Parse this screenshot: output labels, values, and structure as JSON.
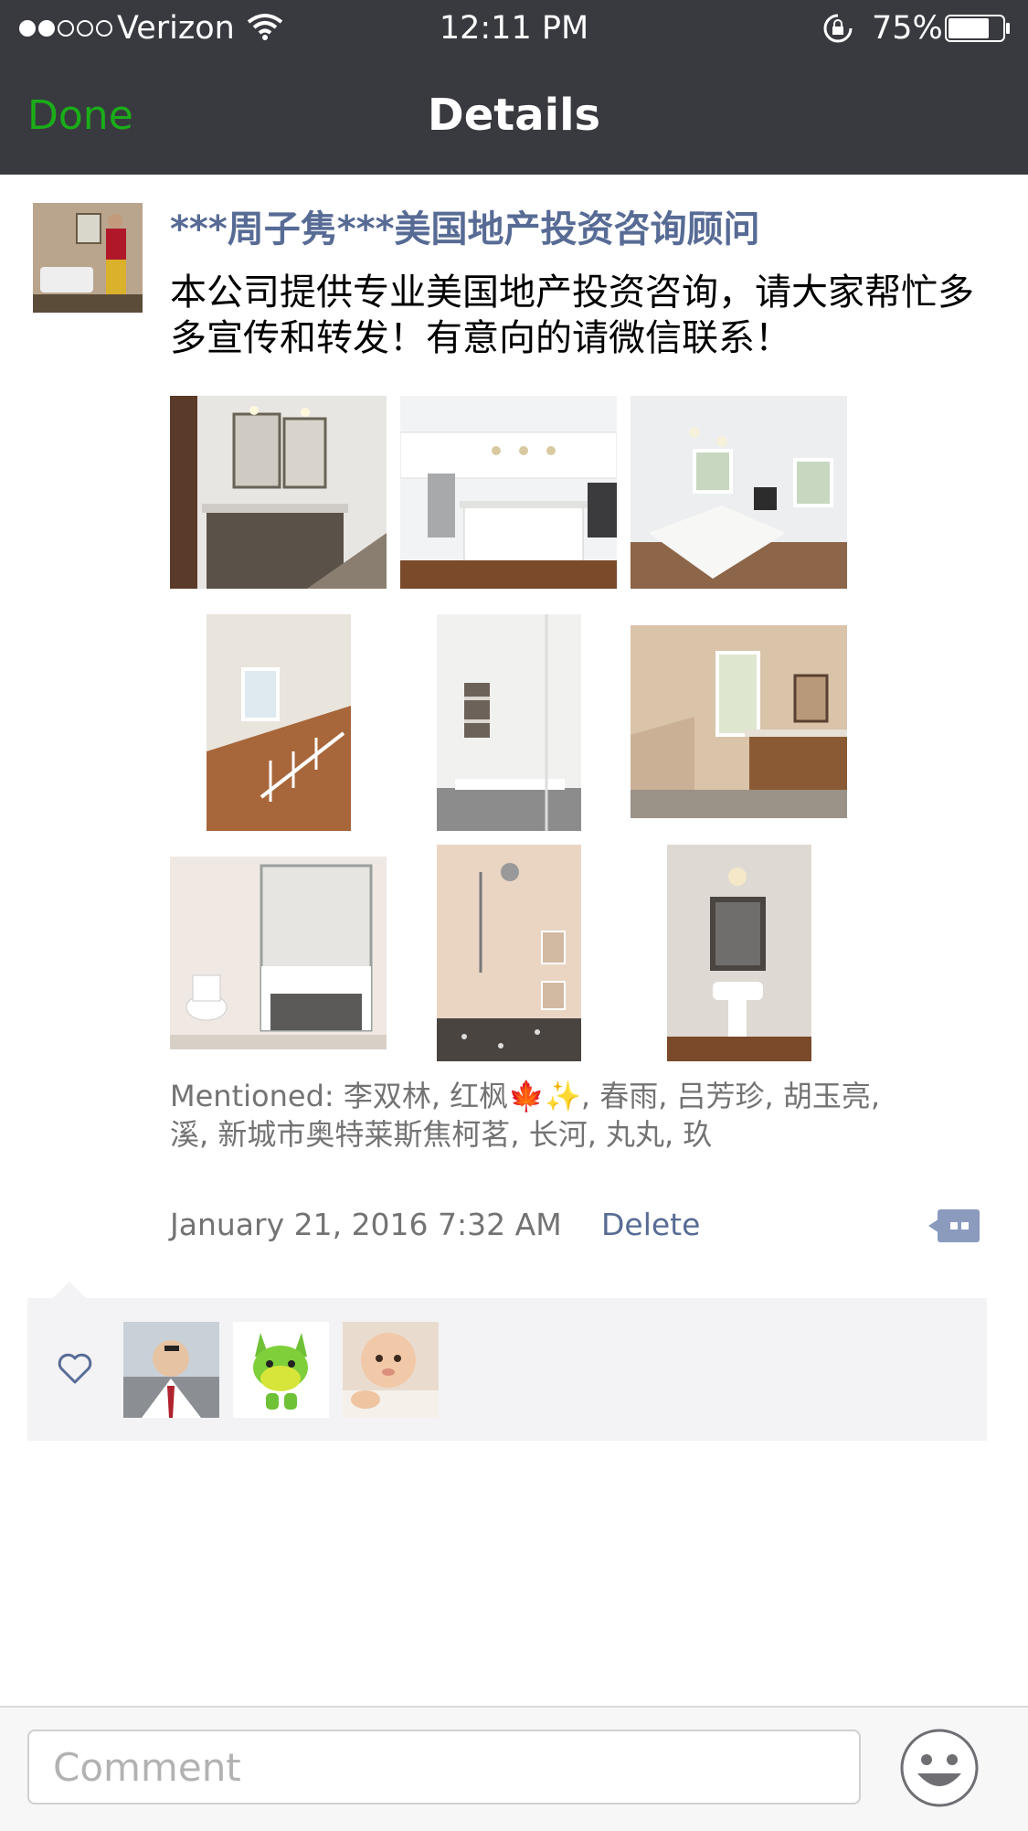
{
  "status_bar": {
    "carrier": "Verizon",
    "time": "12:11 PM",
    "battery": "75%"
  },
  "nav": {
    "done_label": "Done",
    "title": "Details"
  },
  "post": {
    "author": "***周子隽***美国地产投资咨询顾问",
    "text": "本公司提供专业美国地产投资咨询，请大家帮忙多多宣传和转发！有意向的请微信联系！",
    "photos": [
      "bathroom-vanity-photo",
      "kitchen-island-photo",
      "open-kitchen-living-photo",
      "staircase-photo",
      "white-shower-photo",
      "master-bath-photo",
      "glass-shower-photo",
      "tiled-shower-photo",
      "powder-room-photo"
    ],
    "mentioned": "Mentioned: 李双林, 红枫🍁✨, 春雨, 吕芳珍, 胡玉亮, 溪, 新城市奥特莱斯焦柯茗, 长河, 丸丸, 玖",
    "timestamp": "January 21, 2016 7:32 AM",
    "delete_label": "Delete"
  },
  "likes": {
    "icon": "heart-icon",
    "count_avatars": 3
  },
  "comment_bar": {
    "placeholder": "Comment"
  },
  "colors": {
    "nav_bg": "#393a3f",
    "done_green": "#1aad19",
    "link_blue": "#576b95"
  }
}
